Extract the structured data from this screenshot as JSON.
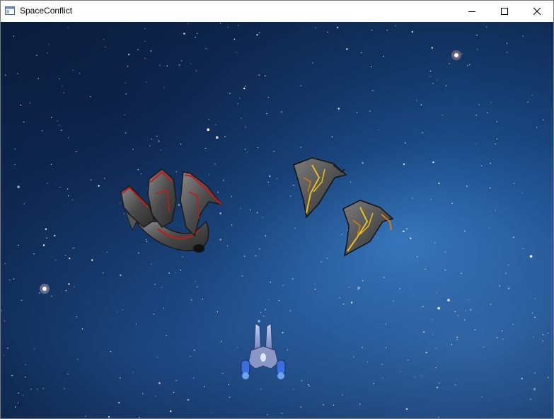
{
  "window": {
    "title": "SpaceConflict",
    "minimize_icon": "minimize-icon",
    "maximize_icon": "maximize-icon",
    "close_icon": "close-icon",
    "app_icon": "app-window-icon"
  },
  "game": {
    "background": "starfield",
    "accent_colors": {
      "space_deep": "#0a1f3e",
      "space_light": "#2f6eb3",
      "enemy_red_trim": "#c81818",
      "enemy_yellow_trim": "#e8c020",
      "player_blue": "#3a6fe0"
    },
    "sprites": [
      {
        "kind": "enemy-cruiser-red-trim"
      },
      {
        "kind": "enemy-fighter-yellow-trim"
      },
      {
        "kind": "enemy-fighter-yellow-trim"
      },
      {
        "kind": "player-ship"
      }
    ]
  }
}
